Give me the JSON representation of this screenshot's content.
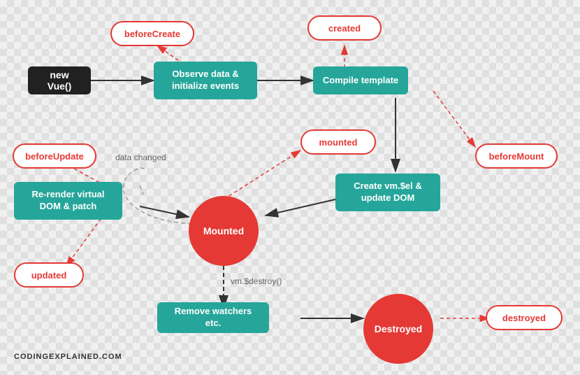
{
  "nodes": {
    "newVue": {
      "label": "new Vue()"
    },
    "observeData": {
      "label": "Observe data &\ninitialize events"
    },
    "compileTemplate": {
      "label": "Compile template"
    },
    "createVm": {
      "label": "Create vm.$el &\nupdate DOM"
    },
    "mounted": {
      "label": "Mounted"
    },
    "removeWatchers": {
      "label": "Remove watchers etc."
    },
    "destroyed": {
      "label": "Destroyed"
    },
    "reRender": {
      "label": "Re-render virtual\nDOM & patch"
    },
    "beforeCreate": {
      "label": "beforeCreate"
    },
    "created": {
      "label": "created"
    },
    "beforeMount": {
      "label": "beforeMount"
    },
    "mountedHook": {
      "label": "mounted"
    },
    "beforeUpdate": {
      "label": "beforeUpdate"
    },
    "updated": {
      "label": "updated"
    },
    "destroyedHook": {
      "label": "destroyed"
    }
  },
  "labels": {
    "dataChanged": "data changed",
    "vmDestroy": "vm.$destroy()",
    "watermark": "CODINGEXPLAINED.COM"
  }
}
